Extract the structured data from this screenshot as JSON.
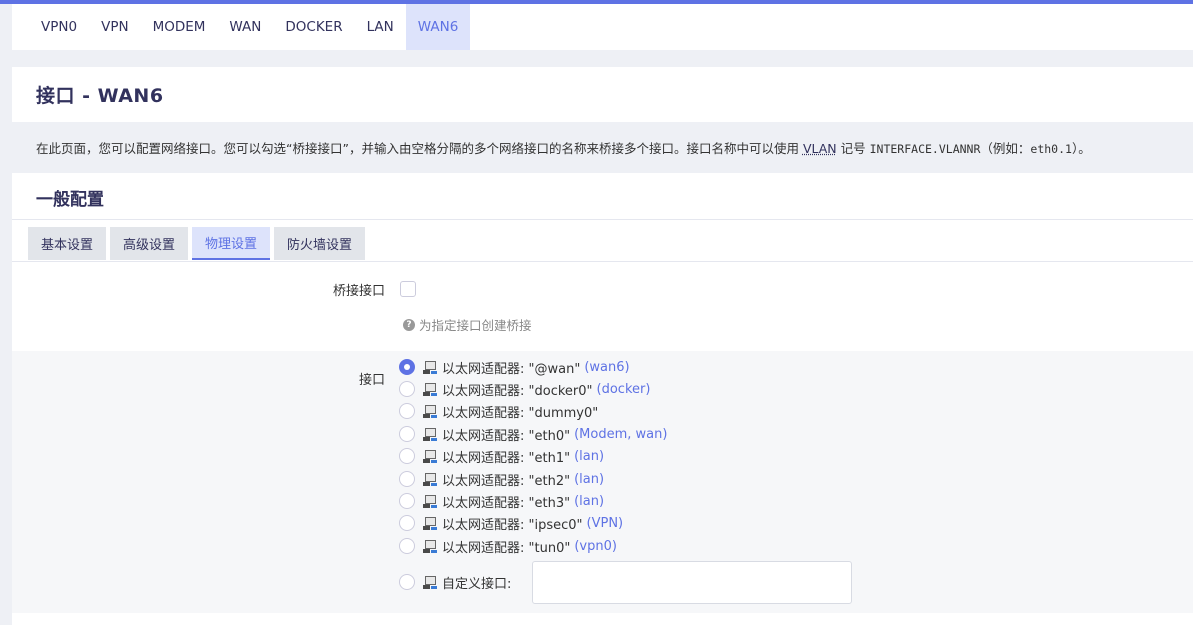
{
  "interface_tabs": [
    {
      "label": "VPN0",
      "active": false
    },
    {
      "label": "VPN",
      "active": false
    },
    {
      "label": "MODEM",
      "active": false
    },
    {
      "label": "WAN",
      "active": false
    },
    {
      "label": "DOCKER",
      "active": false
    },
    {
      "label": "LAN",
      "active": false
    },
    {
      "label": "WAN6",
      "active": true
    }
  ],
  "page": {
    "title": "接口 - WAN6",
    "description_pre": "在此页面，您可以配置网络接口。您可以勾选“桥接接口”，并输入由空格分隔的多个网络接口的名称来桥接多个接口。接口名称中可以使用 ",
    "description_vlan": "VLAN",
    "description_mid": " 记号 ",
    "description_code1": "INTERFACE.VLANNR",
    "description_mid2": "（例如：",
    "description_code2": "eth0.1",
    "description_end": "）。"
  },
  "section": {
    "title": "一般配置",
    "tabs": [
      {
        "label": "基本设置",
        "active": false
      },
      {
        "label": "高级设置",
        "active": false
      },
      {
        "label": "物理设置",
        "active": true
      },
      {
        "label": "防火墙设置",
        "active": false
      }
    ]
  },
  "bridge": {
    "label": "桥接接口",
    "checked": false,
    "hint": "为指定接口创建桥接"
  },
  "interface": {
    "label": "接口",
    "options": [
      {
        "text": "以太网适配器: \"@wan\"",
        "networks": "(wan6)",
        "checked": true
      },
      {
        "text": "以太网适配器: \"docker0\"",
        "networks": "(docker)",
        "checked": false
      },
      {
        "text": "以太网适配器: \"dummy0\"",
        "networks": "",
        "checked": false
      },
      {
        "text": "以太网适配器: \"eth0\"",
        "networks": "(Modem, wan)",
        "checked": false
      },
      {
        "text": "以太网适配器: \"eth1\"",
        "networks": "(lan)",
        "checked": false
      },
      {
        "text": "以太网适配器: \"eth2\"",
        "networks": "(lan)",
        "checked": false
      },
      {
        "text": "以太网适配器: \"eth3\"",
        "networks": "(lan)",
        "checked": false
      },
      {
        "text": "以太网适配器: \"ipsec0\"",
        "networks": "(VPN)",
        "checked": false
      },
      {
        "text": "以太网适配器: \"tun0\"",
        "networks": "(vpn0)",
        "checked": false
      }
    ],
    "custom_label": "自定义接口:",
    "custom_value": ""
  },
  "colors": {
    "accent": "#5e72e4",
    "active_tab_bg": "#dde3fb"
  },
  "icons": {
    "ethernet": "ethernet-adapter-icon",
    "help": "help-circle-icon"
  }
}
